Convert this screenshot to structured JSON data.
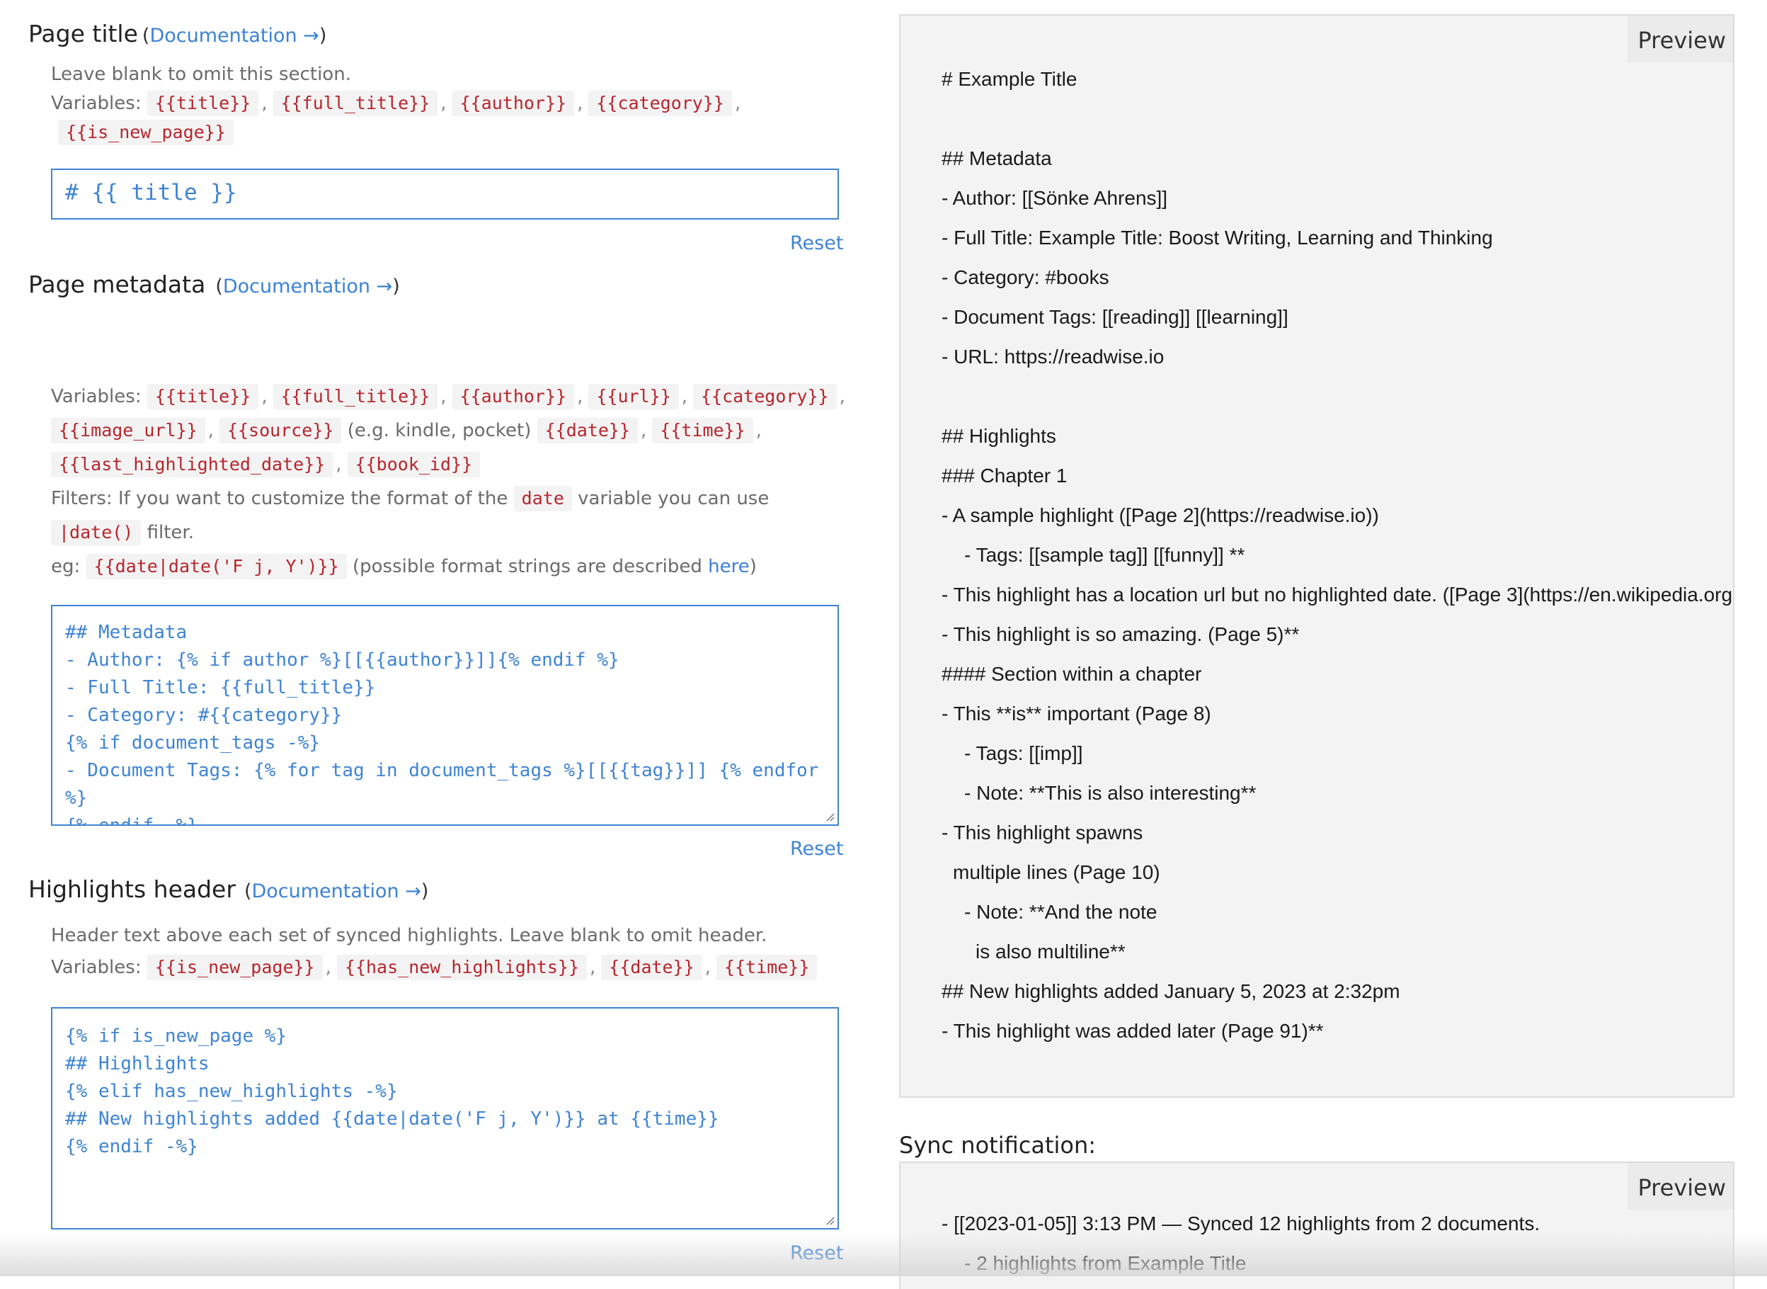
{
  "page_title_section": {
    "title": "Page title",
    "doc_link": "Documentation →",
    "hint": "Leave blank to omit this section.",
    "variables_label": "Variables:",
    "variables": [
      "{{title}}",
      "{{full_title}}",
      "{{author}}",
      "{{category}}",
      "{{is_new_page}}"
    ],
    "editor_value": "# {{ title }}",
    "reset_label": "Reset"
  },
  "metadata_section": {
    "title": "Page metadata",
    "doc_link": "Documentation →",
    "variables_label": "Variables:",
    "variables_row1": [
      "{{title}}",
      "{{full_title}}",
      "{{author}}",
      "{{url}}",
      "{{category}}"
    ],
    "variables_row2": [
      "{{image_url}}",
      "{{source}}"
    ],
    "source_note": "(e.g. kindle, pocket)",
    "variables_row2b": [
      "{{date}}",
      "{{time}}"
    ],
    "variables_row3": [
      "{{last_highlighted_date}}",
      "{{book_id}}"
    ],
    "filters_text": "Filters: If you want to customize the format of the",
    "filters_code": "date",
    "filters_text2": "variable you can use",
    "filter_code": "|date()",
    "filter_text": "filter.",
    "eg_label": "eg:",
    "eg_code": "{{date|date('F j, Y')}}",
    "eg_note": "(possible format strings are described",
    "eg_link": "here",
    "eg_close": ")",
    "editor_lines": [
      "## Metadata",
      "- Author: {% if author %}[[{{author}}]]{% endif %}",
      "- Full Title: {{full_title}}",
      "- Category: #{{category}}",
      "{% if document_tags -%}",
      "- Document Tags: {% for tag in document_tags %}[[{{tag}}]] {% endfor",
      "%}",
      "{% endif -%}"
    ],
    "reset_label": "Reset"
  },
  "highlights_header_section": {
    "title": "Highlights header",
    "doc_link": "Documentation →",
    "hint": "Header text above each set of synced highlights. Leave blank to omit header.",
    "variables_label": "Variables:",
    "variables": [
      "{{is_new_page}}",
      "{{has_new_highlights}}",
      "{{date}}",
      "{{time}}"
    ],
    "editor_lines": [
      "{% if is_new_page %}",
      "## Highlights",
      "{% elif has_new_highlights -%}",
      "## New highlights added {{date|date('F j, Y')}} at {{time}}",
      "{% endif -%}"
    ],
    "reset_label": "Reset"
  },
  "preview_panel": {
    "tab_label": "Preview",
    "lines": [
      "# Example Title",
      "## Metadata",
      "- Author: [[Sönke Ahrens]]",
      "- Full Title: Example Title: Boost Writing, Learning and Thinking",
      "- Category: #books",
      "- Document Tags: [[reading]] [[learning]]",
      "- URL: https://readwise.io",
      "## Highlights",
      "### Chapter 1",
      "- A sample highlight ([Page 2](https://readwise.io))",
      "- Tags: [[sample tag]] [[funny]] **",
      "- This highlight has a location url but no highlighted date. ([Page 3](https://en.wikipedia.org",
      "- This highlight is so amazing. (Page 5)**",
      "#### Section within a chapter",
      "- This **is** important (Page 8)",
      "- Tags: [[imp]]",
      "- Note: **This is also interesting**",
      "- This highlight spawns",
      "multiple lines (Page 10)",
      "- Note: **And the note",
      "is also multiline**",
      "## New highlights added January 5, 2023 at 2:32pm",
      "- This highlight was added later (Page 91)**"
    ]
  },
  "sync_notification": {
    "label": "Sync notification:",
    "tab_label": "Preview",
    "lines": [
      "- [[2023-01-05]] 3:13 PM — Synced 12 highlights from 2 documents.",
      "- 2 highlights from Example Title"
    ]
  }
}
